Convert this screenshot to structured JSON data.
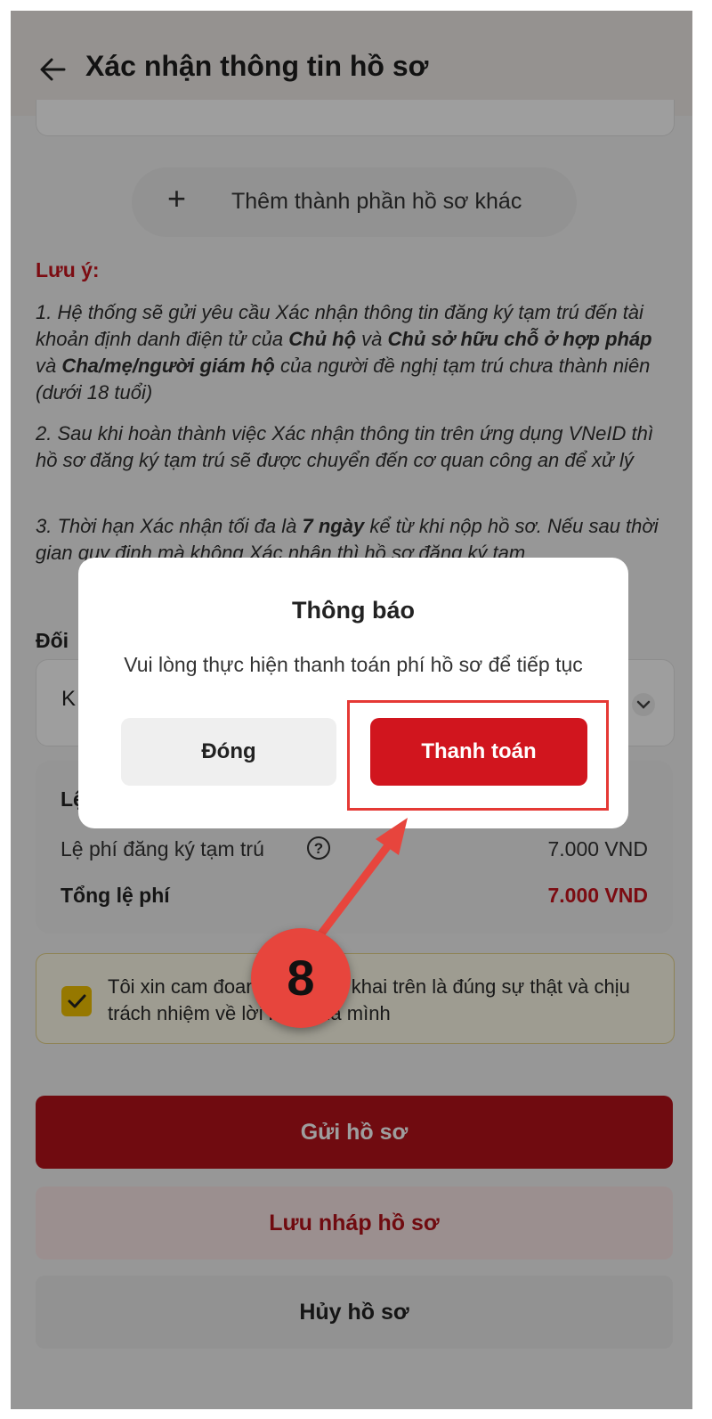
{
  "header": {
    "title": "Xác nhận thông tin hồ sơ"
  },
  "add_component": {
    "label": "Thêm thành phần hồ sơ khác"
  },
  "note": {
    "title": "Lưu ý:",
    "item1": {
      "p1": "1. Hệ thống sẽ gửi yêu cầu Xác nhận thông tin đăng ký tạm trú đến tài khoản định danh điện tử của ",
      "b1": "Chủ hộ",
      "p2": " và ",
      "b2": "Chủ sở hữu chỗ ở hợp pháp",
      "p3": " và ",
      "b3": "Cha/mẹ/người giám hộ",
      "p4": " của người đề nghị tạm trú chưa thành niên (dưới 18 tuổi)"
    },
    "item2": "2. Sau khi hoàn thành việc Xác nhận thông tin trên ứng dụng VNeID thì hồ sơ đăng ký tạm trú sẽ được chuyển đến cơ quan công an để xử lý",
    "item3": {
      "p1": "3. Thời hạn Xác nhận tối đa là ",
      "b1": "7 ngày",
      "p2": " kể từ khi nộp hồ sơ. Nếu sau thời gian quy định mà không Xác nhận thì hồ sơ đăng ký tạm"
    }
  },
  "section_label": "Đối",
  "select_value": "K",
  "fees": {
    "heading": "Lệ",
    "row_label": "Lệ phí đăng ký tạm trú",
    "row_value": "7.000 VND",
    "total_label": "Tổng lệ phí",
    "total_value": "7.000 VND"
  },
  "commitment": {
    "text": "Tôi xin cam đoan những lời khai trên là đúng sự thật và chịu trách nhiệm về lời khai của mình",
    "checked": true
  },
  "buttons": {
    "send": "Gửi hồ sơ",
    "draft": "Lưu nháp hồ sơ",
    "cancel": "Hủy hồ sơ"
  },
  "dialog": {
    "title": "Thông báo",
    "message": "Vui lòng thực hiện thanh toán phí hồ sơ để tiếp tục",
    "close_label": "Đóng",
    "pay_label": "Thanh toán"
  },
  "annotation": {
    "step": "8"
  },
  "colors": {
    "primary_red": "#b5121b",
    "accent_red": "#d1151e",
    "checkbox_yellow": "#f2c200",
    "highlight": "#e53935"
  },
  "icons": [
    "back-arrow-icon",
    "plus-icon",
    "chevron-down-icon",
    "help-circle-icon",
    "check-icon"
  ]
}
